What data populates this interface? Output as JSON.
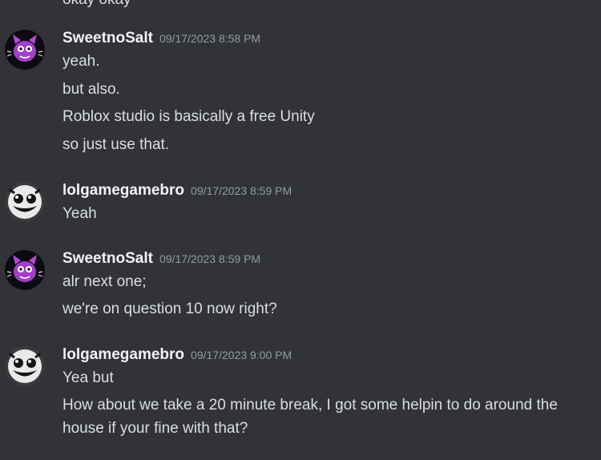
{
  "partial_top_text": "okay okay",
  "messages": [
    {
      "author": "SweetnoSalt",
      "avatar_icon": "purple-cat-avatar-icon",
      "timestamp": "09/17/2023 8:58 PM",
      "lines": [
        "yeah.",
        "but also.",
        "Roblox studio is basically a free Unity",
        "so just use that."
      ]
    },
    {
      "author": "lolgamegamebro",
      "avatar_icon": "grinning-face-avatar-icon",
      "timestamp": "09/17/2023 8:59 PM",
      "lines": [
        "Yeah"
      ]
    },
    {
      "author": "SweetnoSalt",
      "avatar_icon": "purple-cat-avatar-icon",
      "timestamp": "09/17/2023 8:59 PM",
      "lines": [
        "alr next one;",
        "we're on question 10 now right?"
      ]
    },
    {
      "author": "lolgamegamebro",
      "avatar_icon": "grinning-face-avatar-icon",
      "timestamp": "09/17/2023 9:00 PM",
      "lines": [
        "Yea but",
        "How about we take a 20 minute break, I got some helpin to do around the house if your fine with that?"
      ]
    }
  ],
  "colors": {
    "background": "#313338",
    "username": "#f2f3f5",
    "message_text": "#dbdee1",
    "timestamp": "#949ba4"
  }
}
